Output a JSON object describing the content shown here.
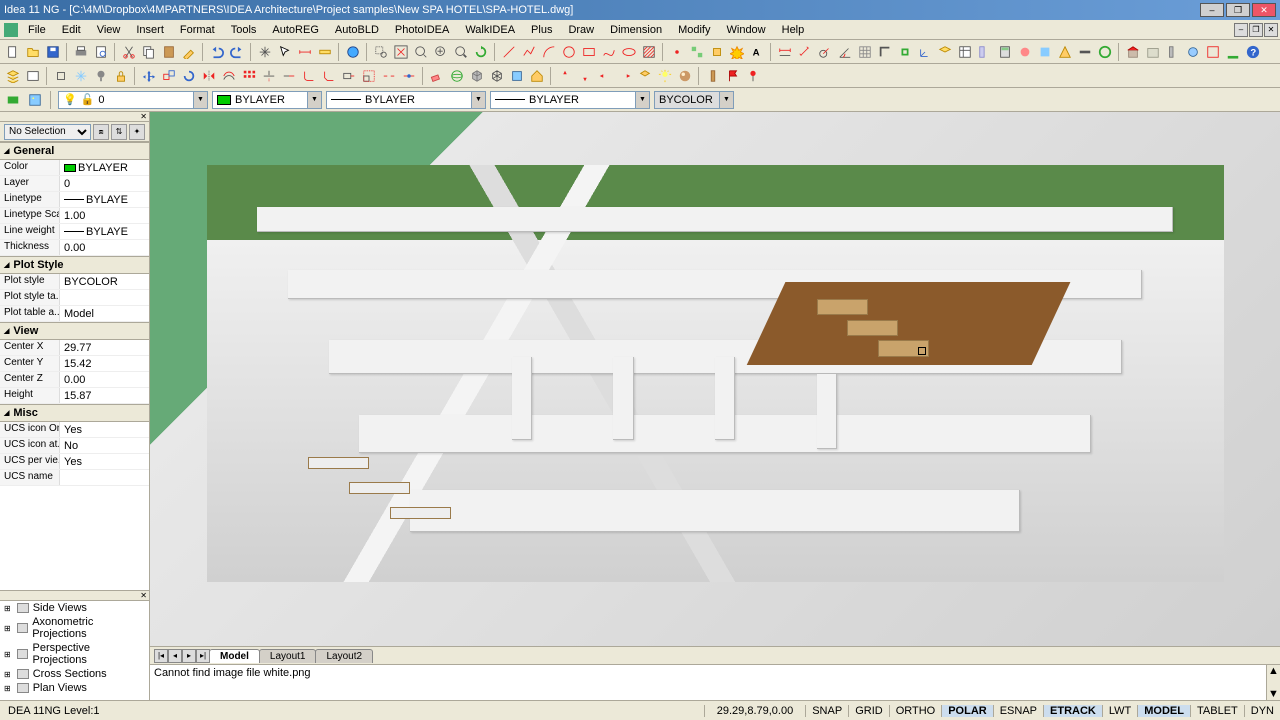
{
  "title": "Idea 11 NG  - [C:\\4M\\Dropbox\\4MPARTNERS\\IDEA Architecture\\Project samples\\New SPA HOTEL\\SPA-HOTEL.dwg]",
  "menus": [
    "File",
    "Edit",
    "View",
    "Insert",
    "Format",
    "Tools",
    "AutoREG",
    "AutoBLD",
    "PhotoIDEA",
    "WalkIDEA",
    "Plus",
    "Draw",
    "Dimension",
    "Modify",
    "Window",
    "Help"
  ],
  "layer_combo": {
    "layer": "0",
    "color": "BYLAYER",
    "linetype": "BYLAYER",
    "lineweight": "BYLAYER",
    "plotstyle": "BYCOLOR"
  },
  "prop_panel": {
    "selection": "No Selection",
    "cats": [
      {
        "name": "General",
        "rows": [
          {
            "n": "Color",
            "v": "BYLAYER",
            "swatch": true
          },
          {
            "n": "Layer",
            "v": "0"
          },
          {
            "n": "Linetype",
            "v": "BYLAYE",
            "line": true
          },
          {
            "n": "Linetype Scale",
            "v": "1.00"
          },
          {
            "n": "Line weight",
            "v": "BYLAYE",
            "line": true
          },
          {
            "n": "Thickness",
            "v": "0.00"
          }
        ]
      },
      {
        "name": "Plot Style",
        "rows": [
          {
            "n": "Plot style",
            "v": "BYCOLOR"
          },
          {
            "n": "Plot style ta...",
            "v": ""
          },
          {
            "n": "Plot table a...",
            "v": "Model"
          }
        ]
      },
      {
        "name": "View",
        "rows": [
          {
            "n": "Center X",
            "v": "29.77"
          },
          {
            "n": "Center Y",
            "v": "15.42"
          },
          {
            "n": "Center Z",
            "v": "0.00"
          },
          {
            "n": "Height",
            "v": "15.87"
          }
        ]
      },
      {
        "name": "Misc",
        "rows": [
          {
            "n": "UCS icon On",
            "v": "Yes"
          },
          {
            "n": "UCS icon at...",
            "v": "No"
          },
          {
            "n": "UCS per vie...",
            "v": "Yes"
          },
          {
            "n": "UCS name",
            "v": ""
          }
        ]
      }
    ]
  },
  "view_tree": [
    "Side Views",
    "Axonometric Projections",
    "Perspective Projections",
    "Cross Sections",
    "Plan Views"
  ],
  "tabs": {
    "items": [
      "Model",
      "Layout1",
      "Layout2"
    ],
    "active": 0
  },
  "cmd_line": "Cannot find image file white.png",
  "status": {
    "left": "DEA 11NG Level:1",
    "coords": "29.29,8.79,0.00",
    "toggles": [
      {
        "t": "SNAP",
        "on": false
      },
      {
        "t": "GRID",
        "on": false
      },
      {
        "t": "ORTHO",
        "on": false
      },
      {
        "t": "POLAR",
        "on": true
      },
      {
        "t": "ESNAP",
        "on": false
      },
      {
        "t": "ETRACK",
        "on": true
      },
      {
        "t": "LWT",
        "on": false
      },
      {
        "t": "MODEL",
        "on": true
      },
      {
        "t": "TABLET",
        "on": false
      },
      {
        "t": "DYN",
        "on": false
      }
    ]
  }
}
